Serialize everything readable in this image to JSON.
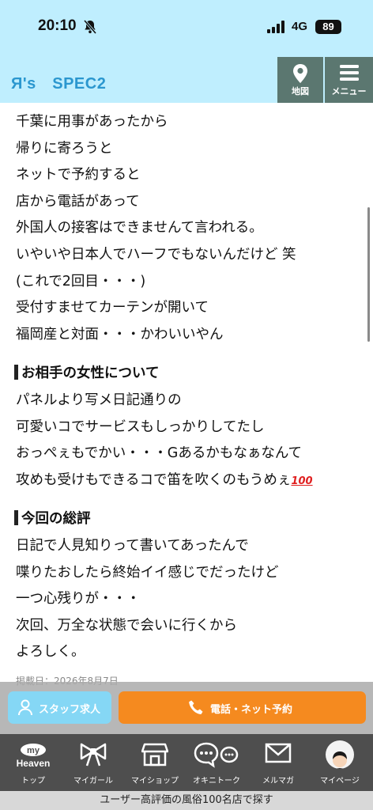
{
  "status_bar": {
    "time": "20:10",
    "network": "4G",
    "battery": "89"
  },
  "header": {
    "shop_name": "Я's　SPEC2",
    "map_label": "地図",
    "menu_label": "メニュー"
  },
  "review": {
    "intro_lines": [
      "千葉に用事があったから",
      "帰りに寄ろうと",
      "ネットで予約すると",
      "店から電話があって",
      "外国人の接客はできませんて言われる。",
      "いやいや日本人でハーフでもないんだけど 笑",
      "(これで2回目・・・)",
      "受付すませてカーテンが開いて",
      "福岡産と対面・・・かわいいやん"
    ],
    "section1_title": "お相手の女性について",
    "section1_lines": [
      "パネルより写メ日記通りの",
      "可愛いコでサービスもしっかりしてたし",
      "おっぺぇもでかい・・・Gあるかもなぁなんて",
      "攻めも受けもできるコで笛を吹くのもうめぇ"
    ],
    "emoji": "100",
    "section2_title": "今回の総評",
    "section2_lines": [
      "日記で人見知りって書いてあったんで",
      "喋りたおしたら終始イイ感じでだったけど",
      "一つ心残りが・・・",
      "次回、万全な状態で会いに行くから",
      "よろしく。"
    ],
    "posted_date": "掲載日：2026年8月7日"
  },
  "cta": {
    "staff_label": "スタッフ求人",
    "call_label": "電話・ネット予約"
  },
  "tabs": [
    {
      "label": "トップ",
      "icon": "my-heaven-logo"
    },
    {
      "label": "マイガール",
      "icon": "ribbon-icon"
    },
    {
      "label": "マイショップ",
      "icon": "shop-icon"
    },
    {
      "label": "オキニトーク",
      "icon": "chat-icon"
    },
    {
      "label": "メルマガ",
      "icon": "mail-icon"
    },
    {
      "label": "マイページ",
      "icon": "avatar"
    }
  ],
  "logo_text": {
    "top": "my",
    "bottom": "Heaven"
  },
  "footer_banner": "ユーザー高評価の風俗100名店で探す",
  "colors": {
    "header_bg": "#bfeefe",
    "brand_blue": "#2b97cf",
    "cta_orange": "#f58a1f",
    "staff_blue": "#85d7f5",
    "tab_bg": "#4e4e4e",
    "header_btn": "#5b7770"
  }
}
